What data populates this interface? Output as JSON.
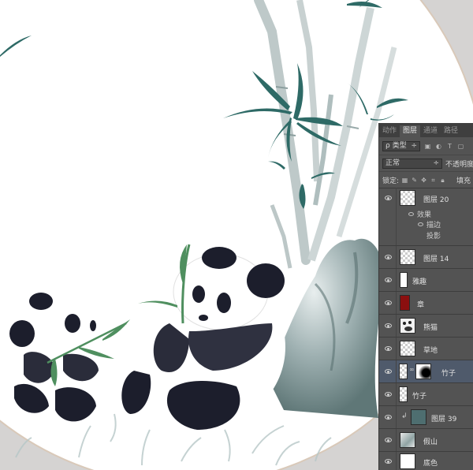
{
  "panel": {
    "tabs": [
      "动作",
      "图层",
      "通道",
      "路径"
    ],
    "active_tab": 1,
    "filter_kind": "ρ 类型",
    "blend_mode": "正常",
    "opacity_label": "不透明度",
    "lock_label": "锁定:",
    "fill_label": "填充"
  },
  "layers": [
    {
      "name": "图层 20",
      "thumb": "checker",
      "sub": [
        "效果",
        "描边",
        "投影"
      ]
    },
    {
      "name": "图层 14",
      "thumb": "checker"
    },
    {
      "name": "雅趣",
      "thumb": "white"
    },
    {
      "name": "章",
      "thumb": "red"
    },
    {
      "name": "熊猫",
      "thumb": "panda"
    },
    {
      "name": "草地",
      "thumb": "checker"
    },
    {
      "name": "竹子",
      "thumb": "bamboo-mask",
      "selected": true
    },
    {
      "name": "竹子",
      "thumb": "bamboo"
    },
    {
      "name": "图层 39",
      "thumb": "teal",
      "clipped": true
    },
    {
      "name": "假山",
      "thumb": "rock"
    },
    {
      "name": "底色",
      "thumb": "white"
    }
  ],
  "colors": {
    "panel_bg": "#535353",
    "selected_row": "#4f5a6b",
    "bamboo_green": "#2e6a66",
    "panda_ink": "#1c1e2c",
    "seal_red": "#8b0f0f",
    "backdrop": "#d5d3d2"
  }
}
